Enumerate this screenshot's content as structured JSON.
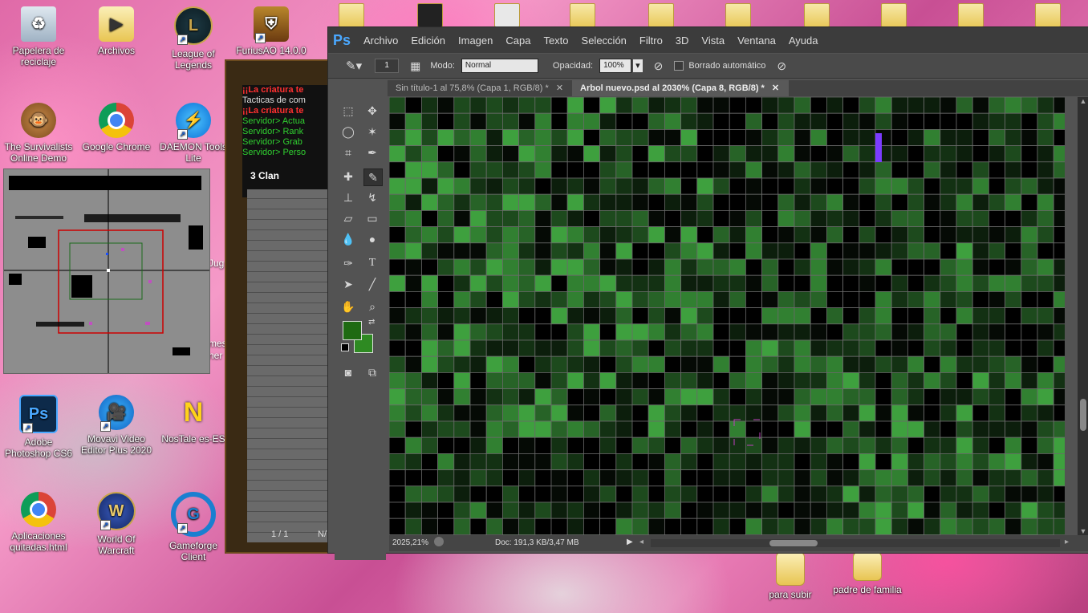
{
  "desktop": {
    "icons_left": [
      {
        "label": "Papelera de reciclaje",
        "icon": "recycle-bin-icon"
      },
      {
        "label": "Archivos",
        "icon": "folder-icon"
      },
      {
        "label": "League of Legends",
        "icon": "league-icon"
      },
      {
        "label": "FuriusAO 14.0.0",
        "icon": "furius-icon"
      },
      {
        "label": "The Survivalists Online Demo",
        "icon": "monkey-icon"
      },
      {
        "label": "Google Chrome",
        "icon": "chrome-icon"
      },
      {
        "label": "DAEMON Tools Lite",
        "icon": "daemon-icon"
      },
      {
        "label": "Adobe Photoshop CS6",
        "icon": "photoshop-icon"
      },
      {
        "label": "Movavi Video Editor Plus 2020",
        "icon": "movavi-icon"
      },
      {
        "label": "NosTale es-ES",
        "icon": "nostale-icon"
      },
      {
        "label": "Aplicaciones quitadas.html",
        "icon": "chrome-icon"
      },
      {
        "label": "World Of Warcraft",
        "icon": "wow-icon"
      },
      {
        "label": "Gameforge Client",
        "icon": "gameforge-icon"
      }
    ],
    "partial_labels": [
      "Jug",
      "mes",
      "ner"
    ],
    "icons_bottom_right": [
      {
        "label": "para subir",
        "icon": "folder-icon"
      },
      {
        "label": "padre de familia",
        "icon": "folder-icon"
      }
    ]
  },
  "game": {
    "chat": [
      {
        "text": "¡¡La criatura te",
        "color": "#ff3030"
      },
      {
        "text": "Tacticas de com",
        "color": "#e0e0e0"
      },
      {
        "text": "¡¡La criatura te",
        "color": "#ff3030"
      },
      {
        "text": "Servidor> Actua",
        "color": "#30d030"
      },
      {
        "text": "Servidor> Rank",
        "color": "#30d030"
      },
      {
        "text": "Servidor> Grab",
        "color": "#30d030"
      },
      {
        "text": "Servidor> Perso",
        "color": "#30d030"
      }
    ],
    "clan": "3 Clan",
    "bottom_counter": "1 / 1",
    "bottom_right": "N/"
  },
  "photoshop": {
    "logo": "Ps",
    "menu": [
      "Archivo",
      "Edición",
      "Imagen",
      "Capa",
      "Texto",
      "Selección",
      "Filtro",
      "3D",
      "Vista",
      "Ventana",
      "Ayuda"
    ],
    "options": {
      "brush_size": "1",
      "mode_label": "Modo:",
      "mode_value": "Normal",
      "opacity_label": "Opacidad:",
      "opacity_value": "100%",
      "auto_erase": "Borrado automático"
    },
    "tabs": [
      {
        "label": "Sin título-1 al 75,8% (Capa 1, RGB/8) *",
        "active": false
      },
      {
        "label": "Arbol nuevo.psd al 2030% (Capa 8, RGB/8) *",
        "active": true
      }
    ],
    "status": {
      "zoom": "2025,21%",
      "doc": "Doc: 191,3 KB/3,47 MB"
    },
    "colors": {
      "foreground": "#1e6a12",
      "background": "#2e8a22"
    }
  }
}
